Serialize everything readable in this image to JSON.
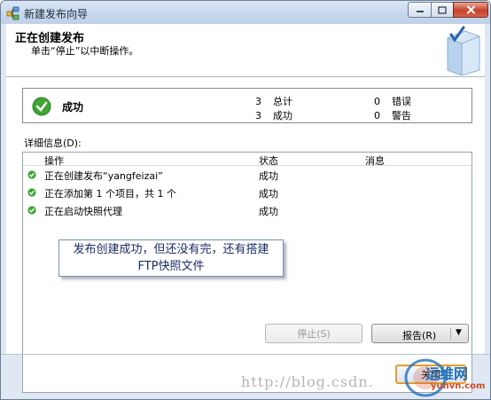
{
  "window": {
    "title": "新建发布向导"
  },
  "titlebar_buttons": {
    "minimize_icon": "minimize-icon",
    "maximize_icon": "maximize-icon",
    "close_icon": "close-icon"
  },
  "header": {
    "title": "正在创建发布",
    "subtitle": "单击“停止”以中断操作。"
  },
  "summary": {
    "status": "成功",
    "total_count": "3",
    "total_label": "总计",
    "success_count": "3",
    "success_label": "成功",
    "error_count": "0",
    "error_label": "错误",
    "warning_count": "0",
    "warning_label": "警告"
  },
  "details": {
    "label": "详细信息(D):",
    "columns": [
      "操作",
      "状态",
      "消息"
    ],
    "rows": [
      {
        "action": "正在创建发布“yangfeizai”",
        "status": "成功",
        "message": ""
      },
      {
        "action": "正在添加第 1 个项目，共 1 个",
        "status": "成功",
        "message": ""
      },
      {
        "action": "正在启动快照代理",
        "status": "成功",
        "message": ""
      }
    ]
  },
  "callout": {
    "line1": "发布创建成功，但还没有完，还有搭建",
    "line2": "FTP快照文件"
  },
  "buttons": {
    "stop": "停止(S)",
    "report": "报告(R)",
    "close": "关闭"
  },
  "watermark": {
    "text": "http://blog.csdn.",
    "logo_text": "运维网",
    "logo_url": "yunvn.com"
  },
  "colors": {
    "success_green": "#3fa535",
    "callout_text": "#1a2c66",
    "close_highlight": "#e89e2a"
  }
}
